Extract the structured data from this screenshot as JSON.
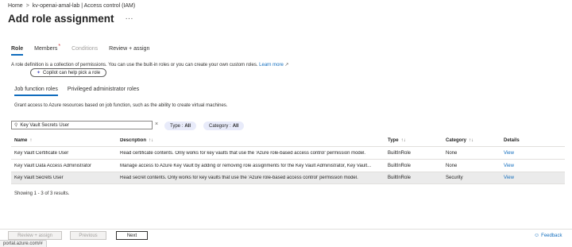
{
  "breadcrumb": {
    "home": "Home",
    "separator": ">",
    "resource": "kv-openai-amal-lab | Access control (IAM)"
  },
  "page": {
    "title": "Add role assignment",
    "more": "···"
  },
  "wizard_tabs": [
    {
      "label": "Role",
      "state": "active"
    },
    {
      "label": "Members",
      "state": "required",
      "marker": "*"
    },
    {
      "label": "Conditions",
      "state": "disabled"
    },
    {
      "label": "Review + assign",
      "state": "normal"
    }
  ],
  "description": {
    "text": "A role definition is a collection of permissions. You can use the built-in roles or you can create your own custom roles.",
    "link": "Learn more",
    "link_icon": "external-link-icon"
  },
  "copilot_button": {
    "label": "Copilot can help pick a role",
    "icon": "copilot-icon"
  },
  "sub_tabs": [
    {
      "label": "Job function roles",
      "active": true
    },
    {
      "label": "Privileged administrator roles",
      "active": false
    }
  ],
  "grant_text": "Grant access to Azure resources based on job function, such as the ability to create virtual machines.",
  "search": {
    "value": "Key Vault Secrets User",
    "icon": "search-icon",
    "clear": "×"
  },
  "filters": [
    {
      "label": "Type :",
      "value": "All"
    },
    {
      "label": "Category :",
      "value": "All"
    }
  ],
  "table": {
    "headers": {
      "name": "Name",
      "description": "Description",
      "type": "Type",
      "category": "Category",
      "details": "Details",
      "sort_icon": "↑↓"
    },
    "rows": [
      {
        "name": "Key Vault Certificate User",
        "description": "Read certificate contents. Only works for key vaults that use the 'Azure role-based access control' permission model.",
        "type": "BuiltInRole",
        "category": "None",
        "details": "View",
        "selected": false
      },
      {
        "name": "Key Vault Data Access Administrator",
        "description": "Manage access to Azure Key Vault by adding or removing role assignments for the Key Vault Administrator, Key Vault...",
        "type": "BuiltInRole",
        "category": "None",
        "details": "View",
        "selected": false
      },
      {
        "name": "Key Vault Secrets User",
        "description": "Read secret contents. Only works for key vaults that use the 'Azure role-based access control' permission model.",
        "type": "BuiltInRole",
        "category": "Security",
        "details": "View",
        "selected": true
      }
    ]
  },
  "showing": "Showing 1 - 3 of 3 results.",
  "footer": {
    "review_assign": "Review + assign",
    "previous": "Previous",
    "next": "Next",
    "feedback": "Feedback"
  },
  "status_url": "portal.azure.com/#",
  "colors": {
    "accent": "#0f6cbd",
    "required": "#d13438",
    "pill_bg": "#e8ebfa",
    "selected_row": "#ebebeb"
  }
}
